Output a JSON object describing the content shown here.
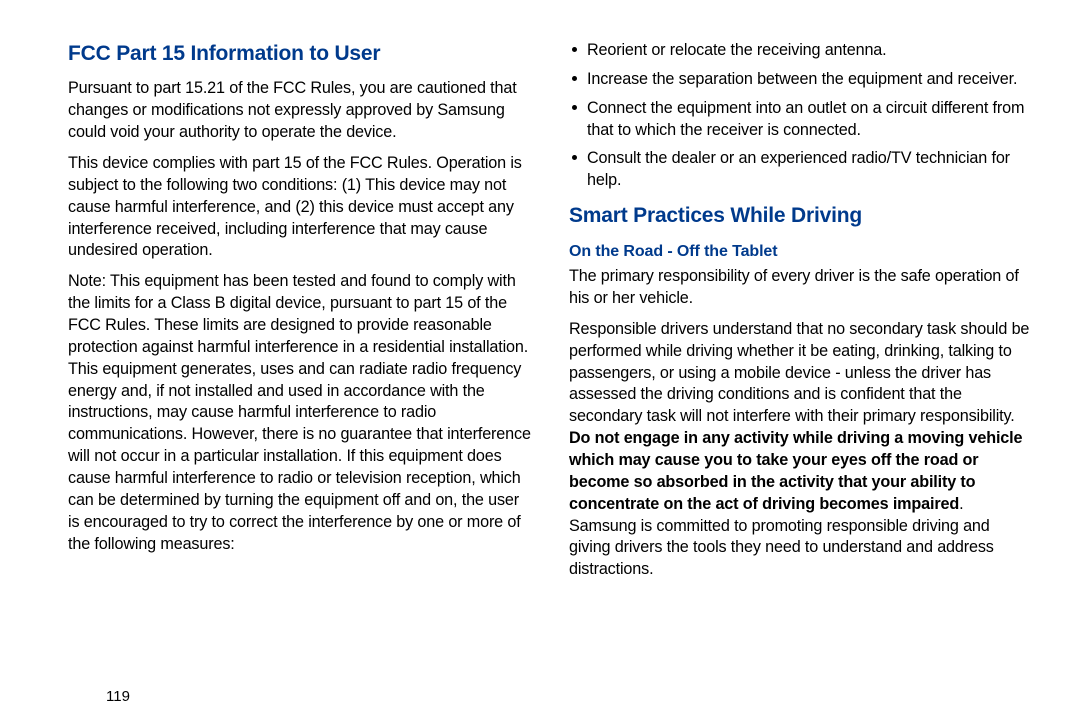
{
  "left": {
    "heading": "FCC Part 15 Information to User",
    "para1": "Pursuant to part 15.21 of the FCC Rules, you are cautioned that changes or modifications not expressly approved by Samsung could void your authority to operate the device.",
    "para2": "This device complies with part 15 of the FCC Rules. Operation is subject to the following two conditions: (1) This device may not cause harmful interference, and (2) this device must accept any interference received, including interference that may cause undesired operation.",
    "para3": "Note: This equipment has been tested and found to comply with the limits for a Class B digital device, pursuant to part 15 of the FCC Rules. These limits are designed to provide reasonable protection against harmful interference in a residential installation. This equipment generates, uses and can radiate radio frequency energy and, if not installed and used in accordance with the instructions, may cause harmful interference to radio communications. However, there is no guarantee that interference will not occur in a particular installation. If this equipment does cause harmful interference to radio or television reception, which can be determined by turning the equipment off and on, the user is encouraged to try to correct the interference by one or more of the following measures:"
  },
  "right": {
    "bullets": [
      "Reorient or relocate the receiving antenna.",
      "Increase the separation between the equipment and receiver.",
      "Connect the equipment into an outlet on a circuit different from that to which the receiver is connected.",
      "Consult the dealer or an experienced radio/TV technician for help."
    ],
    "heading": "Smart Practices While Driving",
    "subheading": "On the Road - Off the Tablet",
    "para1": "The primary responsibility of every driver is the safe operation of his or her vehicle.",
    "para2_a": "Responsible drivers understand that no secondary task should be performed while driving whether it be eating, drinking, talking to passengers, or using a mobile device - unless the driver has assessed the driving conditions and is confident that the secondary task will not interfere with their primary responsibility. ",
    "para2_bold": "Do not engage in any activity while driving a moving vehicle which may cause you to take your eyes off the road or become so absorbed in the activity that your ability to concentrate on the act of driving becomes impaired",
    "para2_c": ". Samsung is committed to promoting responsible driving and giving drivers the tools they need to understand and address distractions."
  },
  "page_number": "119"
}
